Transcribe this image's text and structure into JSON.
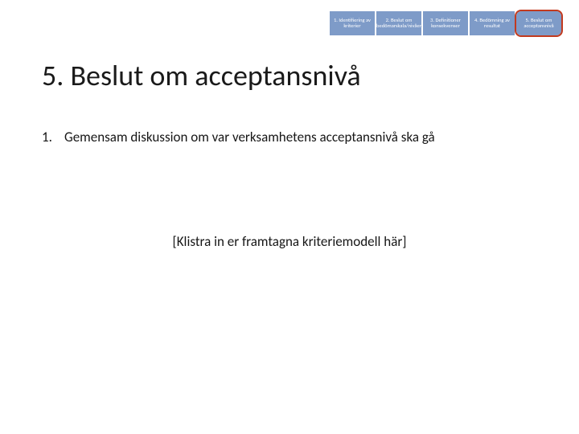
{
  "nav": {
    "steps": [
      {
        "label": "1. Identifiering av kriterier",
        "highlight": false
      },
      {
        "label": "2. Beslut om bedömarskala/nivåer",
        "highlight": false
      },
      {
        "label": "3. Definitioner konsekvenser",
        "highlight": false
      },
      {
        "label": "4. Bedömning av resultat",
        "highlight": false
      },
      {
        "label": "5. Beslut om acceptansnivå",
        "highlight": true
      }
    ]
  },
  "title": "5. Beslut om acceptansnivå",
  "list": {
    "items": [
      {
        "num": "1.",
        "text": "Gemensam diskussion om var verksamhetens acceptansnivå ska gå"
      }
    ]
  },
  "placeholder_hint": "[Klistra in er framtagna kriteriemodell här]"
}
